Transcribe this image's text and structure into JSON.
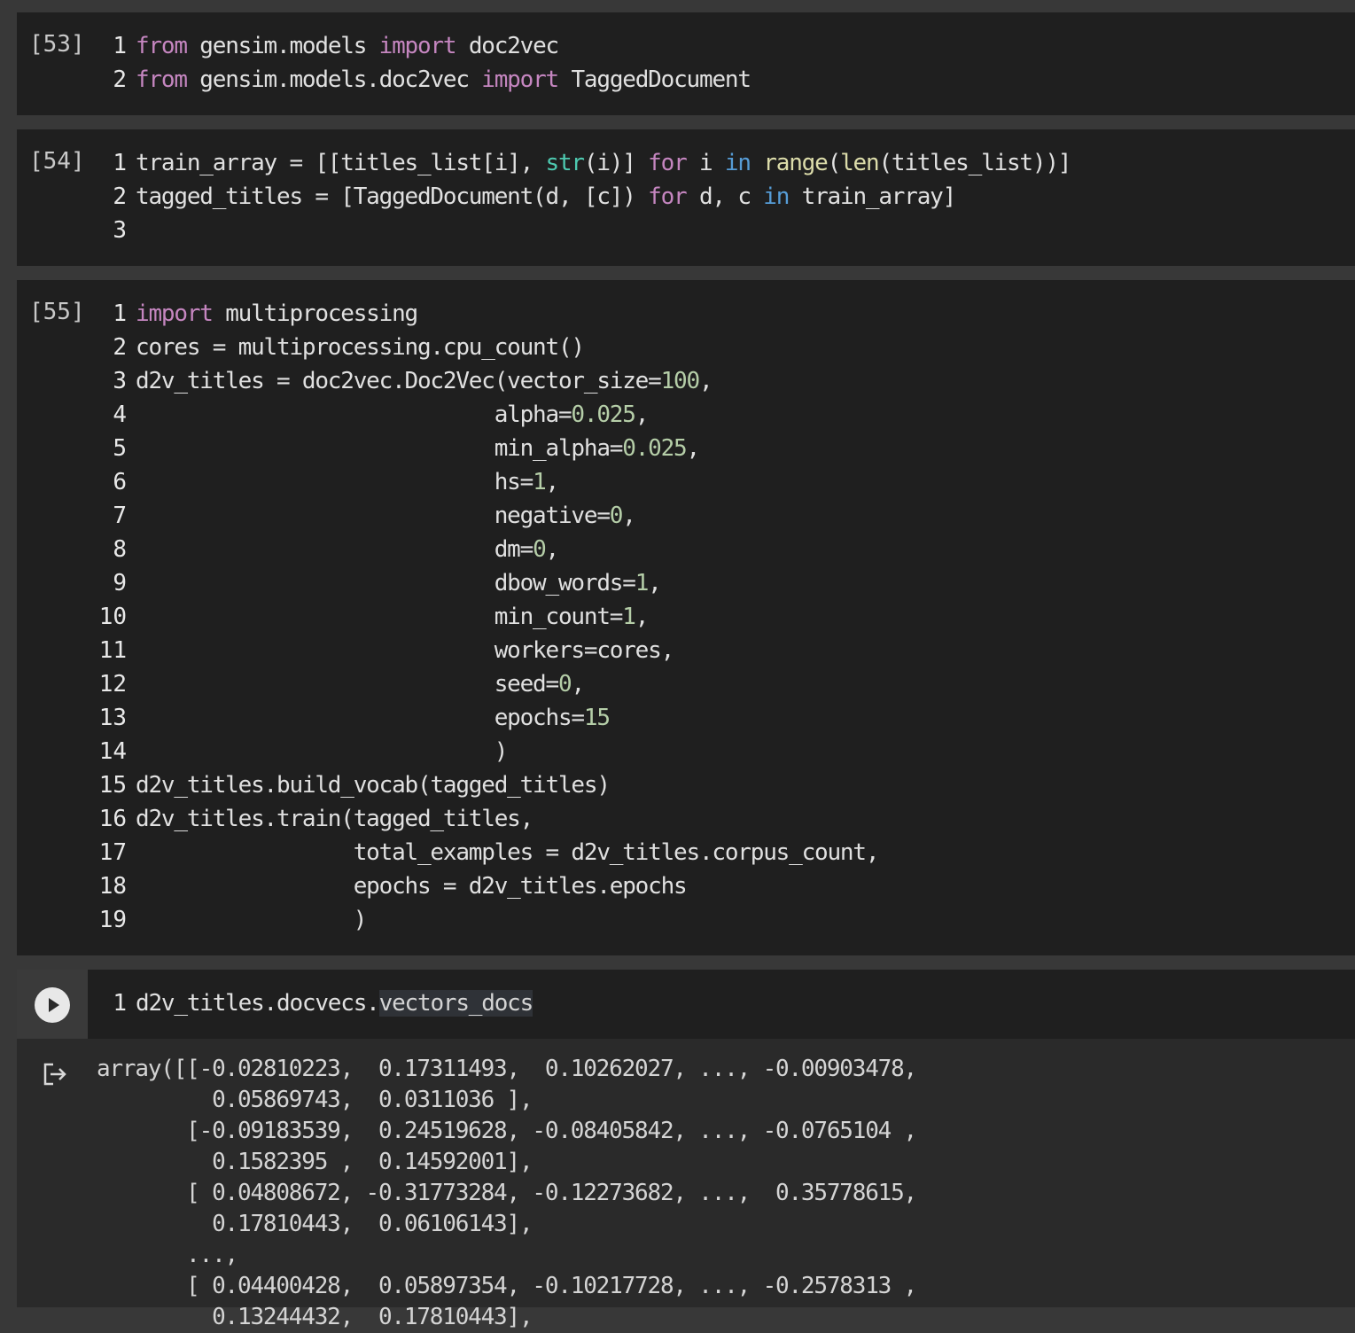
{
  "cells": [
    {
      "label": "[53]",
      "lines": [
        [
          [
            "ln",
            "1"
          ],
          [
            "kw",
            "from"
          ],
          [
            "tx",
            " gensim.models "
          ],
          [
            "kw",
            "import"
          ],
          [
            "tx",
            " doc2vec"
          ]
        ],
        [
          [
            "ln",
            "2"
          ],
          [
            "kw",
            "from"
          ],
          [
            "tx",
            " gensim.models.doc2vec "
          ],
          [
            "kw",
            "import"
          ],
          [
            "tx",
            " TaggedDocument"
          ]
        ]
      ]
    },
    {
      "label": "[54]",
      "lines": [
        [
          [
            "ln",
            "1"
          ],
          [
            "tx",
            "train_array = [[titles_list[i], "
          ],
          [
            "ty",
            "str"
          ],
          [
            "tx",
            "(i)] "
          ],
          [
            "kw",
            "for"
          ],
          [
            "tx",
            " i "
          ],
          [
            "bl",
            "in"
          ],
          [
            "tx",
            " "
          ],
          [
            "fn",
            "range"
          ],
          [
            "tx",
            "("
          ],
          [
            "fn",
            "len"
          ],
          [
            "tx",
            "(titles_list))]"
          ]
        ],
        [
          [
            "ln",
            "2"
          ],
          [
            "tx",
            "tagged_titles = [TaggedDocument(d, [c]) "
          ],
          [
            "kw",
            "for"
          ],
          [
            "tx",
            " d, c "
          ],
          [
            "bl",
            "in"
          ],
          [
            "tx",
            " train_array]"
          ]
        ],
        [
          [
            "ln",
            "3"
          ]
        ]
      ]
    },
    {
      "label": "[55]",
      "lines": [
        [
          [
            "ln",
            "1"
          ],
          [
            "kw",
            "import"
          ],
          [
            "tx",
            " multiprocessing"
          ]
        ],
        [
          [
            "ln",
            "2"
          ],
          [
            "tx",
            "cores = multiprocessing.cpu_count()"
          ]
        ],
        [
          [
            "ln",
            "3"
          ],
          [
            "tx",
            "d2v_titles = doc2vec.Doc2Vec(vector_size="
          ],
          [
            "nm",
            "100"
          ],
          [
            "tx",
            ","
          ]
        ],
        [
          [
            "ln",
            "4"
          ],
          [
            "tx",
            "                            alpha="
          ],
          [
            "nm",
            "0.025"
          ],
          [
            "tx",
            ","
          ]
        ],
        [
          [
            "ln",
            "5"
          ],
          [
            "tx",
            "                            min_alpha="
          ],
          [
            "nm",
            "0.025"
          ],
          [
            "tx",
            ","
          ]
        ],
        [
          [
            "ln",
            "6"
          ],
          [
            "tx",
            "                            hs="
          ],
          [
            "nm",
            "1"
          ],
          [
            "tx",
            ","
          ]
        ],
        [
          [
            "ln",
            "7"
          ],
          [
            "tx",
            "                            negative="
          ],
          [
            "nm",
            "0"
          ],
          [
            "tx",
            ","
          ]
        ],
        [
          [
            "ln",
            "8"
          ],
          [
            "tx",
            "                            dm="
          ],
          [
            "nm",
            "0"
          ],
          [
            "tx",
            ","
          ]
        ],
        [
          [
            "ln",
            "9"
          ],
          [
            "tx",
            "                            dbow_words="
          ],
          [
            "nm",
            "1"
          ],
          [
            "tx",
            ","
          ]
        ],
        [
          [
            "ln",
            "10"
          ],
          [
            "tx",
            "                            min_count="
          ],
          [
            "nm",
            "1"
          ],
          [
            "tx",
            ","
          ]
        ],
        [
          [
            "ln",
            "11"
          ],
          [
            "tx",
            "                            workers=cores,"
          ]
        ],
        [
          [
            "ln",
            "12"
          ],
          [
            "tx",
            "                            seed="
          ],
          [
            "nm",
            "0"
          ],
          [
            "tx",
            ","
          ]
        ],
        [
          [
            "ln",
            "13"
          ],
          [
            "tx",
            "                            epochs="
          ],
          [
            "nm",
            "15"
          ]
        ],
        [
          [
            "ln",
            "14"
          ],
          [
            "tx",
            "                            )"
          ]
        ],
        [
          [
            "ln",
            "15"
          ],
          [
            "tx",
            "d2v_titles.build_vocab(tagged_titles)"
          ]
        ],
        [
          [
            "ln",
            "16"
          ],
          [
            "tx",
            "d2v_titles.train(tagged_titles,"
          ]
        ],
        [
          [
            "ln",
            "17"
          ],
          [
            "tx",
            "                 total_examples = d2v_titles.corpus_count,"
          ]
        ],
        [
          [
            "ln",
            "18"
          ],
          [
            "tx",
            "                 epochs = d2v_titles.epochs"
          ]
        ],
        [
          [
            "ln",
            "19"
          ],
          [
            "tx",
            "                 )"
          ]
        ]
      ]
    }
  ],
  "run_cell": {
    "lines": [
      [
        [
          "ln",
          "1"
        ],
        [
          "tx",
          "d2v_titles.docvecs."
        ],
        [
          "hl",
          "vectors_docs"
        ]
      ]
    ]
  },
  "output": {
    "text": "array([[-0.02810223,  0.17311493,  0.10262027, ..., -0.00903478,\n         0.05869743,  0.0311036 ],\n       [-0.09183539,  0.24519628, -0.08405842, ..., -0.0765104 ,\n         0.1582395 ,  0.14592001],\n       [ 0.04808672, -0.31773284, -0.12273682, ...,  0.35778615,\n         0.17810443,  0.06106143],\n       ...,\n       [ 0.04400428,  0.05897354, -0.10217728, ..., -0.2578313 ,\n         0.13244432,  0.17810443],"
  },
  "colors": {
    "background": "#383838",
    "cell_bg": "#1f1f1f",
    "keyword": "#c586c0",
    "builtin": "#569cd6",
    "number": "#b5cea8"
  }
}
